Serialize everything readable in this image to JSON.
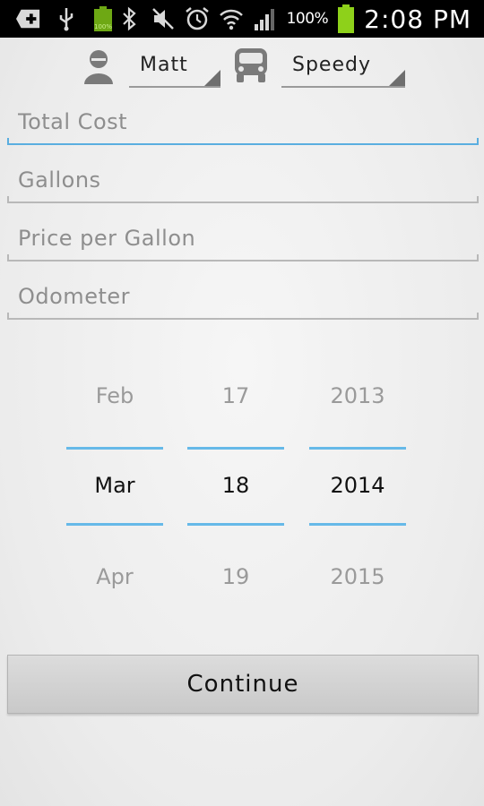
{
  "status_bar": {
    "battery_percent": "100%",
    "battery_badge": "100%",
    "time": "2:08 PM",
    "icons": [
      "add-icon",
      "usb-icon",
      "battery-charging-icon",
      "bluetooth-icon",
      "mute-icon",
      "alarm-icon",
      "wifi-icon",
      "signal-icon",
      "battery-icon"
    ]
  },
  "selectors": {
    "driver": {
      "value": "Matt",
      "icon": "person-icon"
    },
    "vehicle": {
      "value": "Speedy",
      "icon": "car-icon"
    }
  },
  "form": {
    "total_cost": {
      "placeholder": "Total Cost",
      "value": ""
    },
    "gallons": {
      "placeholder": "Gallons",
      "value": ""
    },
    "price_per_gallon": {
      "placeholder": "Price per Gallon",
      "value": ""
    },
    "odometer": {
      "placeholder": "Odometer",
      "value": ""
    }
  },
  "date_picker": {
    "month": {
      "prev": "Feb",
      "current": "Mar",
      "next": "Apr"
    },
    "day": {
      "prev": "17",
      "current": "18",
      "next": "19"
    },
    "year": {
      "prev": "2013",
      "current": "2014",
      "next": "2015"
    }
  },
  "continue_label": "Continue",
  "colors": {
    "accent": "#5aaee0",
    "status_bar": "#000000",
    "battery": "#8ed11a"
  }
}
